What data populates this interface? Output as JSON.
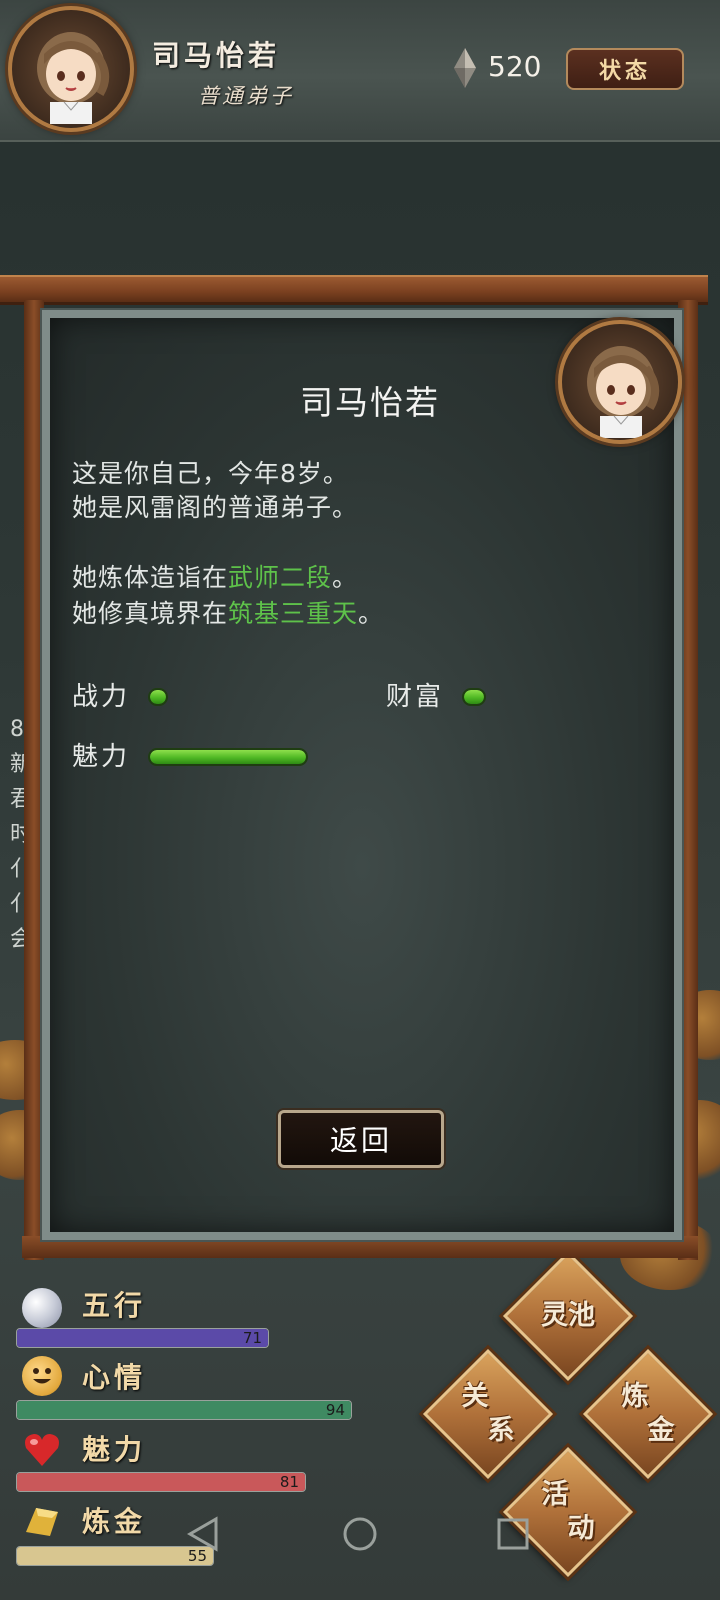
{
  "header": {
    "name": "司马怡若",
    "rank": "普通弟子",
    "gem_count": "520",
    "status_button": "状态"
  },
  "background_text": [
    "8",
    "新",
    "君",
    "时",
    "",
    "亻",
    "亻",
    "会"
  ],
  "stats": [
    {
      "label": "五行",
      "value": "71",
      "percent": 71,
      "color": "#5b4aa8",
      "icon": "pearl-icon"
    },
    {
      "label": "心情",
      "value": "94",
      "percent": 94,
      "color": "#3f8a62",
      "icon": "smiley-icon"
    },
    {
      "label": "魅力",
      "value": "81",
      "percent": 81,
      "color": "#c9585a",
      "icon": "heart-icon"
    },
    {
      "label": "炼金",
      "value": "55",
      "percent": 55,
      "color": "#d8c690",
      "icon": "gold-ingot-icon"
    }
  ],
  "actions": {
    "spirit_pool": "灵池",
    "relations_top": "关",
    "relations_bottom": "系",
    "alchemy_top": "炼",
    "alchemy_bottom": "金",
    "activity_top": "活",
    "activity_bottom": "动"
  },
  "modal": {
    "title": "司马怡若",
    "line1": "这是你自己，今年8岁。",
    "line2": "她是风雷阁的普通弟子。",
    "line3_prefix": "她炼体造诣在",
    "line3_highlight": "武师二段",
    "line3_suffix": "。",
    "line4_prefix": "她修真境界在",
    "line4_highlight": "筑基三重天",
    "line4_suffix": "。",
    "attributes": {
      "combat_label": "战力",
      "combat_level": 0.05,
      "wealth_label": "财富",
      "wealth_level": 0.05,
      "charm_label": "魅力",
      "charm_level": 1.0
    },
    "back_button": "返回"
  },
  "colors": {
    "highlight_green": "#5ec24a",
    "frame_brown": "#8a4e28",
    "gold_text": "#f2d9a8"
  },
  "nav": {
    "back_icon": "triangle-back-icon",
    "home_icon": "circle-home-icon",
    "recent_icon": "square-recent-icon"
  }
}
